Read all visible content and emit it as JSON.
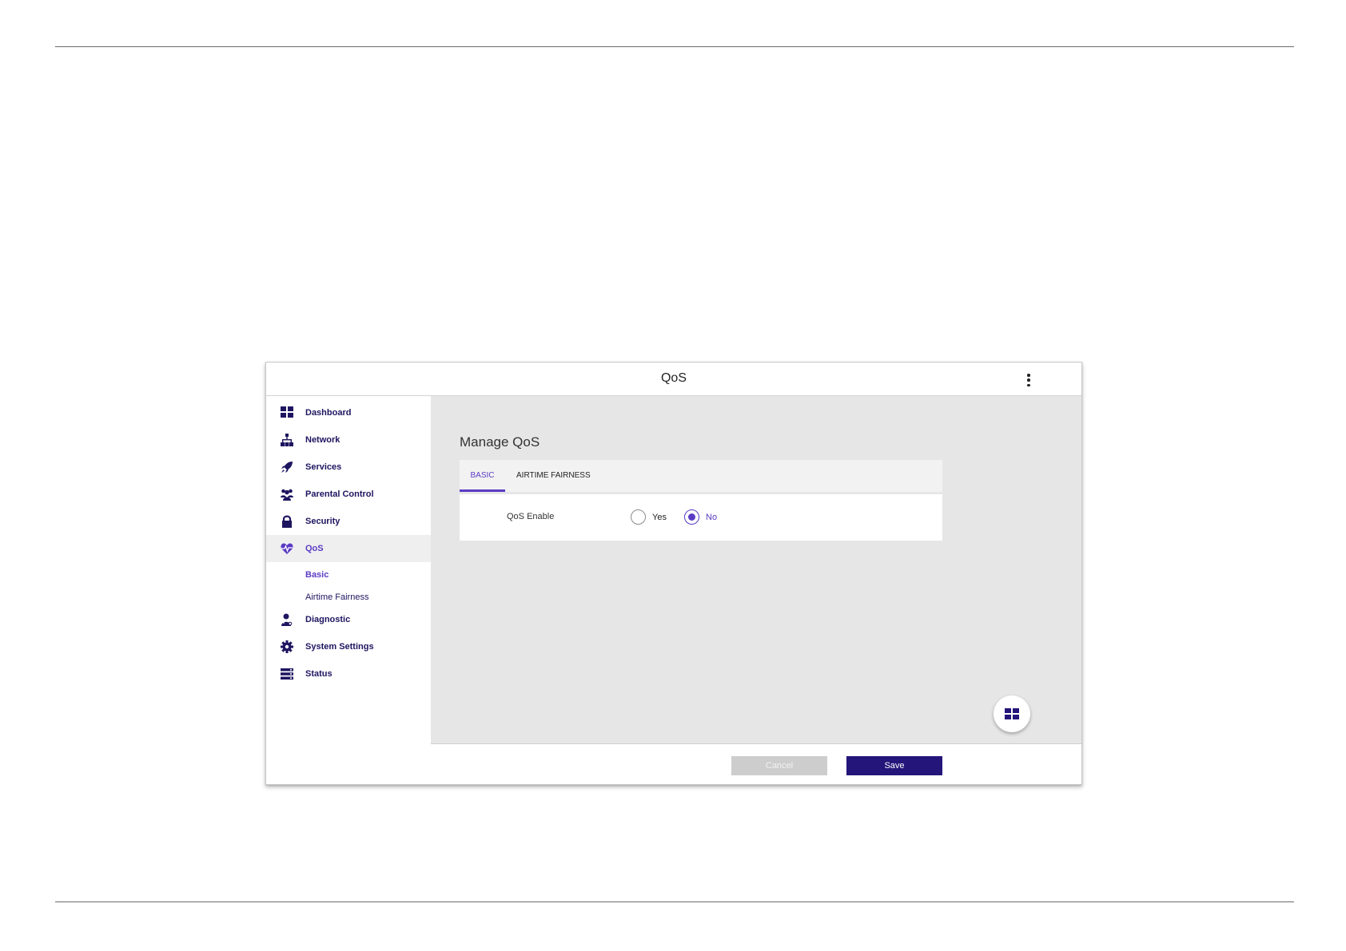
{
  "window": {
    "title": "QoS",
    "menu_icon": "more-vert-icon"
  },
  "sidebar": {
    "items": [
      {
        "label": "Dashboard",
        "icon": "dashboard-grid-icon"
      },
      {
        "label": "Network",
        "icon": "network-tree-icon"
      },
      {
        "label": "Services",
        "icon": "rocket-icon"
      },
      {
        "label": "Parental Control",
        "icon": "users-icon"
      },
      {
        "label": "Security",
        "icon": "lock-icon"
      },
      {
        "label": "QoS",
        "icon": "heartbeat-icon",
        "active": true
      },
      {
        "label": "Diagnostic",
        "icon": "doctor-icon"
      },
      {
        "label": "System Settings",
        "icon": "gear-icon"
      },
      {
        "label": "Status",
        "icon": "server-list-icon"
      }
    ],
    "qos_subitems": [
      {
        "label": "Basic",
        "active": true
      },
      {
        "label": "Airtime Fairness"
      }
    ]
  },
  "main": {
    "heading": "Manage QoS",
    "tabs": [
      {
        "label": "BASIC",
        "active": true
      },
      {
        "label": "AIRTIME FAIRNESS"
      }
    ],
    "qos_enable": {
      "label": "QoS Enable",
      "options": [
        "Yes",
        "No"
      ],
      "selected": "No"
    },
    "fab_icon": "dashboard-grid-icon"
  },
  "footer": {
    "cancel_label": "Cancel",
    "save_label": "Save"
  },
  "colors": {
    "accent": "#5b3bc4",
    "brand_dark": "#24157a",
    "nav_text": "#1e1560",
    "content_bg": "#e6e6e6"
  }
}
